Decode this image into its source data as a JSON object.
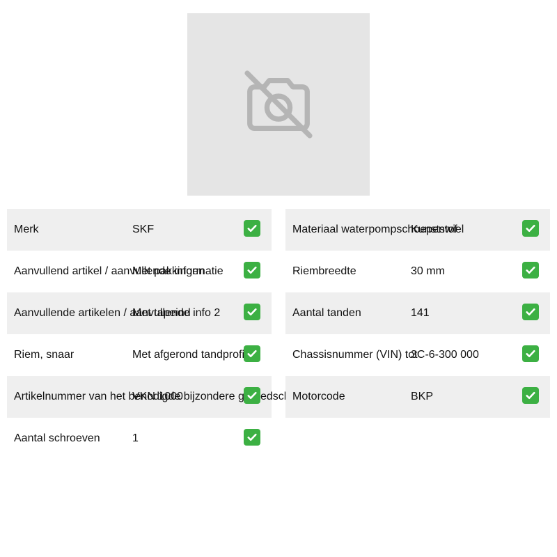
{
  "image": {
    "icon": "camera-off-icon",
    "background": "#e5e5e5"
  },
  "check": {
    "icon": "check-mark-icon",
    "color": "#3cb043"
  },
  "specs_left": [
    {
      "label": "Merk",
      "value": "SKF"
    },
    {
      "label": "Aanvullend artikel / aanvullende informatie",
      "value": "Met pakkingen"
    },
    {
      "label": "Aanvullende artikelen / aanvullende info 2",
      "value": "Met tapeind"
    },
    {
      "label": "Riem, snaar",
      "value": "Met afgerond tandprofiel"
    },
    {
      "label": "Artikelnummer van het benodigde bijzondere gereedschap",
      "value": "VKN 1000"
    },
    {
      "label": "Aantal schroeven",
      "value": "1"
    }
  ],
  "specs_right": [
    {
      "label": "Materiaal waterpompschoepenwiel",
      "value": "Kunststof"
    },
    {
      "label": "Riembreedte",
      "value": "30 mm"
    },
    {
      "label": "Aantal tanden",
      "value": "141"
    },
    {
      "label": "Chassisnummer (VIN) tot",
      "value": "3C-6-300 000"
    },
    {
      "label": "Motorcode",
      "value": "BKP"
    }
  ]
}
